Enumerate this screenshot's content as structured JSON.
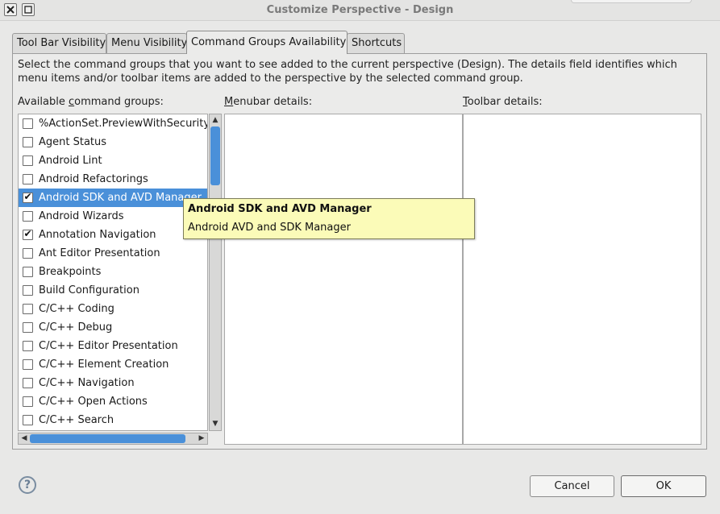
{
  "window": {
    "title": "Customize Perspective - Design"
  },
  "tabs": [
    {
      "label": "Tool Bar Visibility",
      "active": false
    },
    {
      "label": "Menu Visibility",
      "active": false
    },
    {
      "label": "Command Groups Availability",
      "active": true
    },
    {
      "label": "Shortcuts",
      "active": false
    }
  ],
  "description": "Select the command groups that you want to see added to the current perspective (Design).  The details field identifies which menu items and/or toolbar items are added to the perspective by the selected command group.",
  "labels": {
    "available_pre": "Available ",
    "available_mn": "c",
    "available_post": "ommand groups:",
    "menubar_mn": "M",
    "menubar_post": "enubar details:",
    "toolbar_mn": "T",
    "toolbar_post": "oolbar details:"
  },
  "command_groups": [
    {
      "label": "%ActionSet.PreviewWithSecurity",
      "checked": false,
      "selected": false
    },
    {
      "label": "Agent Status",
      "checked": false,
      "selected": false
    },
    {
      "label": "Android Lint",
      "checked": false,
      "selected": false
    },
    {
      "label": "Android Refactorings",
      "checked": false,
      "selected": false
    },
    {
      "label": "Android SDK and AVD Manager",
      "checked": true,
      "selected": true
    },
    {
      "label": "Android Wizards",
      "checked": false,
      "selected": false
    },
    {
      "label": "Annotation Navigation",
      "checked": true,
      "selected": false
    },
    {
      "label": "Ant Editor Presentation",
      "checked": false,
      "selected": false
    },
    {
      "label": "Breakpoints",
      "checked": false,
      "selected": false
    },
    {
      "label": "Build Configuration",
      "checked": false,
      "selected": false
    },
    {
      "label": "C/C++ Coding",
      "checked": false,
      "selected": false
    },
    {
      "label": "C/C++ Debug",
      "checked": false,
      "selected": false
    },
    {
      "label": "C/C++ Editor Presentation",
      "checked": false,
      "selected": false
    },
    {
      "label": "C/C++ Element Creation",
      "checked": false,
      "selected": false
    },
    {
      "label": "C/C++ Navigation",
      "checked": false,
      "selected": false
    },
    {
      "label": "C/C++ Open Actions",
      "checked": false,
      "selected": false
    },
    {
      "label": "C/C++ Search",
      "checked": false,
      "selected": false
    }
  ],
  "tooltip": {
    "title": "Android SDK and AVD Manager",
    "body": "Android AVD and SDK Manager"
  },
  "buttons": {
    "help": "?",
    "cancel": "Cancel",
    "ok": "OK"
  },
  "icons": {
    "close": "close-icon",
    "restore": "restore-icon",
    "checkmark": "✔",
    "scroll_up": "▲",
    "scroll_down": "▼",
    "scroll_left": "◀",
    "scroll_right": "▶"
  },
  "colors": {
    "selection": "#4a90d9",
    "tooltip_bg": "#fbfbb8"
  }
}
